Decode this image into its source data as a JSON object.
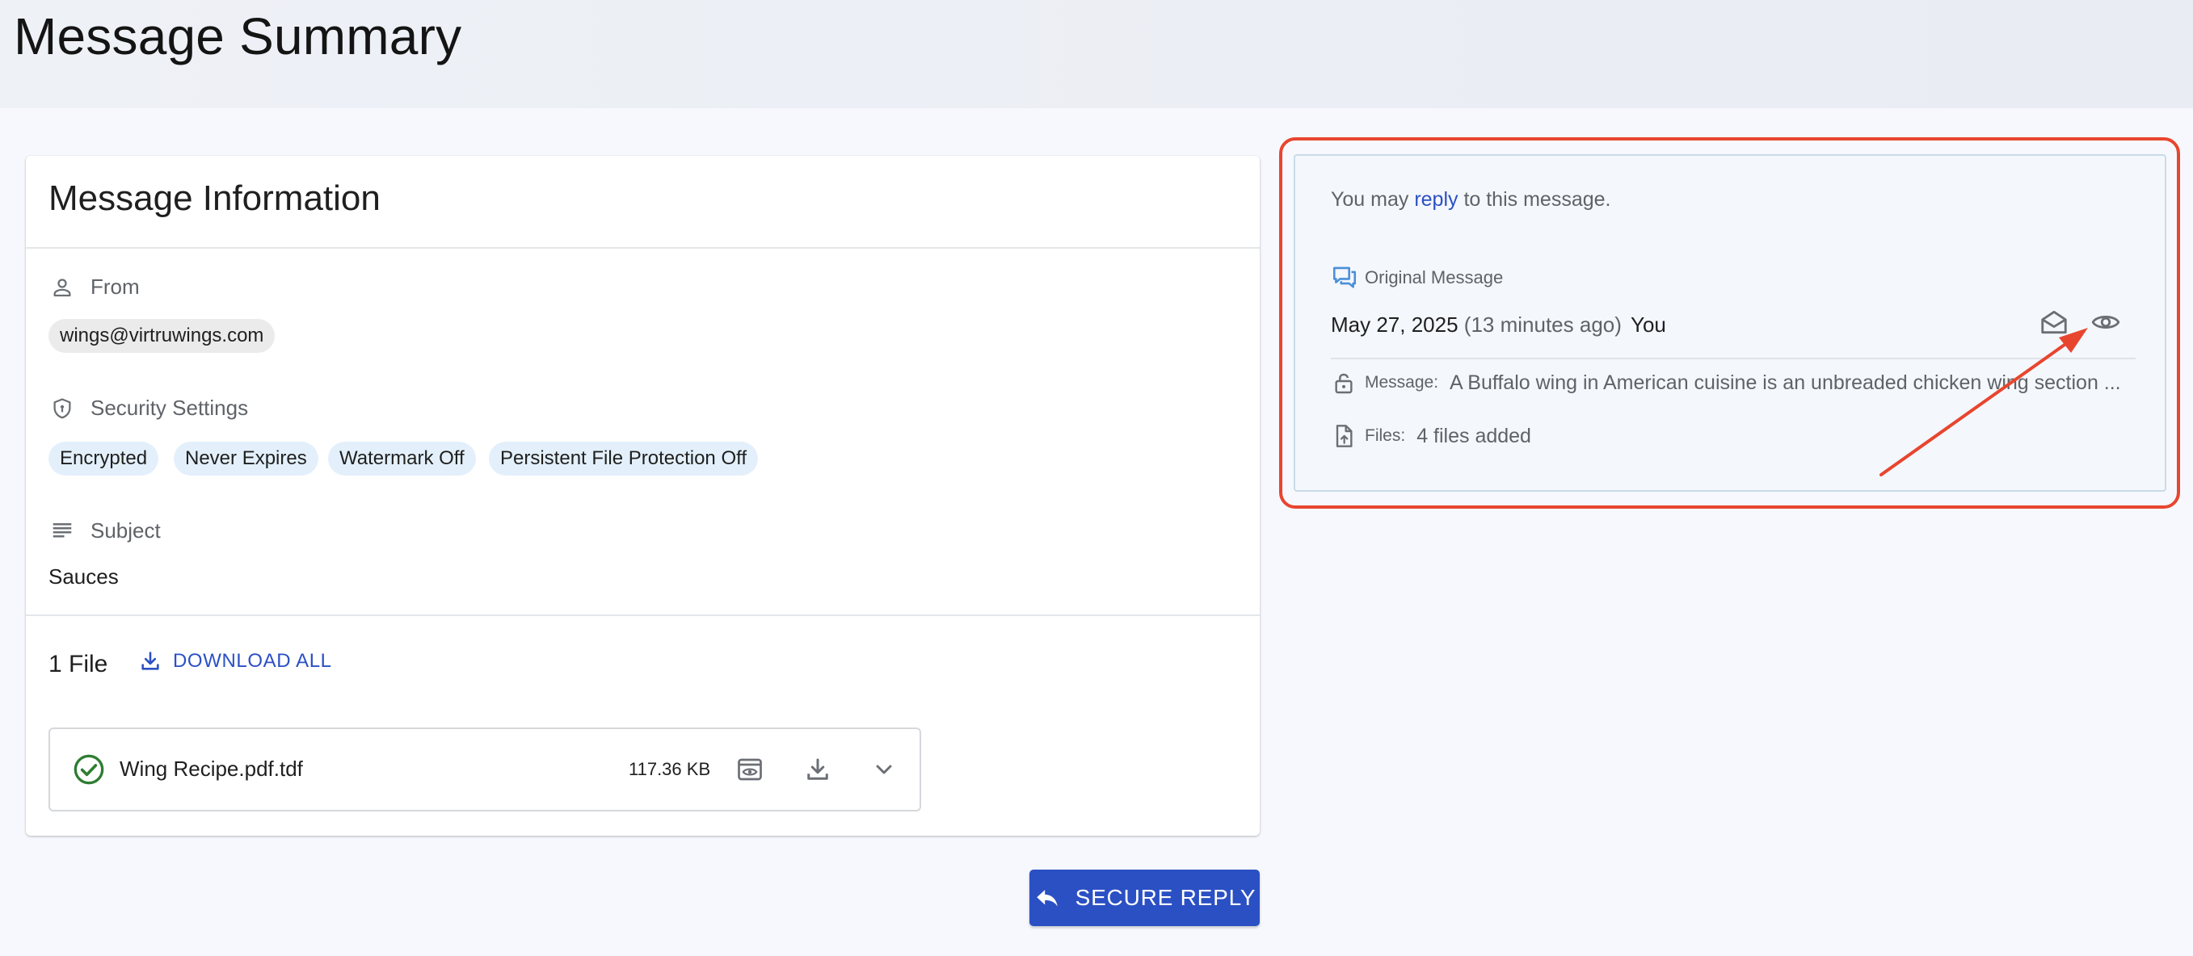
{
  "page": {
    "title": "Message Summary"
  },
  "info_card": {
    "title": "Message Information",
    "from": {
      "label": "From",
      "value": "wings@virtruwings.com",
      "icon": "person-icon"
    },
    "security": {
      "label": "Security Settings",
      "icon": "shield-icon",
      "chips": [
        "Encrypted",
        "Never Expires",
        "Watermark Off",
        "Persistent File Protection Off"
      ]
    },
    "subject": {
      "label": "Subject",
      "value": "Sauces",
      "icon": "subject-lines-icon"
    },
    "files": {
      "count_label": "1 File",
      "download_all_label": "DOWNLOAD ALL",
      "items": [
        {
          "name": "Wing Recipe.pdf.tdf",
          "size": "117.36 KB",
          "status": "ok"
        }
      ]
    }
  },
  "secure_reply": {
    "label": "SECURE REPLY"
  },
  "reply_panel": {
    "note_prefix": "You may ",
    "note_link": "reply",
    "note_suffix": " to this message.",
    "original_label": "Original Message",
    "date": "May 27, 2025",
    "ago": "(13 minutes ago)",
    "sender": "You",
    "message_key": "Message:",
    "message_value": "A Buffalo wing in American cuisine is an unbreaded chicken wing section ...",
    "files_key": "Files:",
    "files_value": "4 files added"
  },
  "colors": {
    "accent": "#2b50c4",
    "highlight": "#e8452f",
    "success": "#2e7d32",
    "chip_blue": "#e3f0fb",
    "chip_grey": "#ebebeb"
  }
}
